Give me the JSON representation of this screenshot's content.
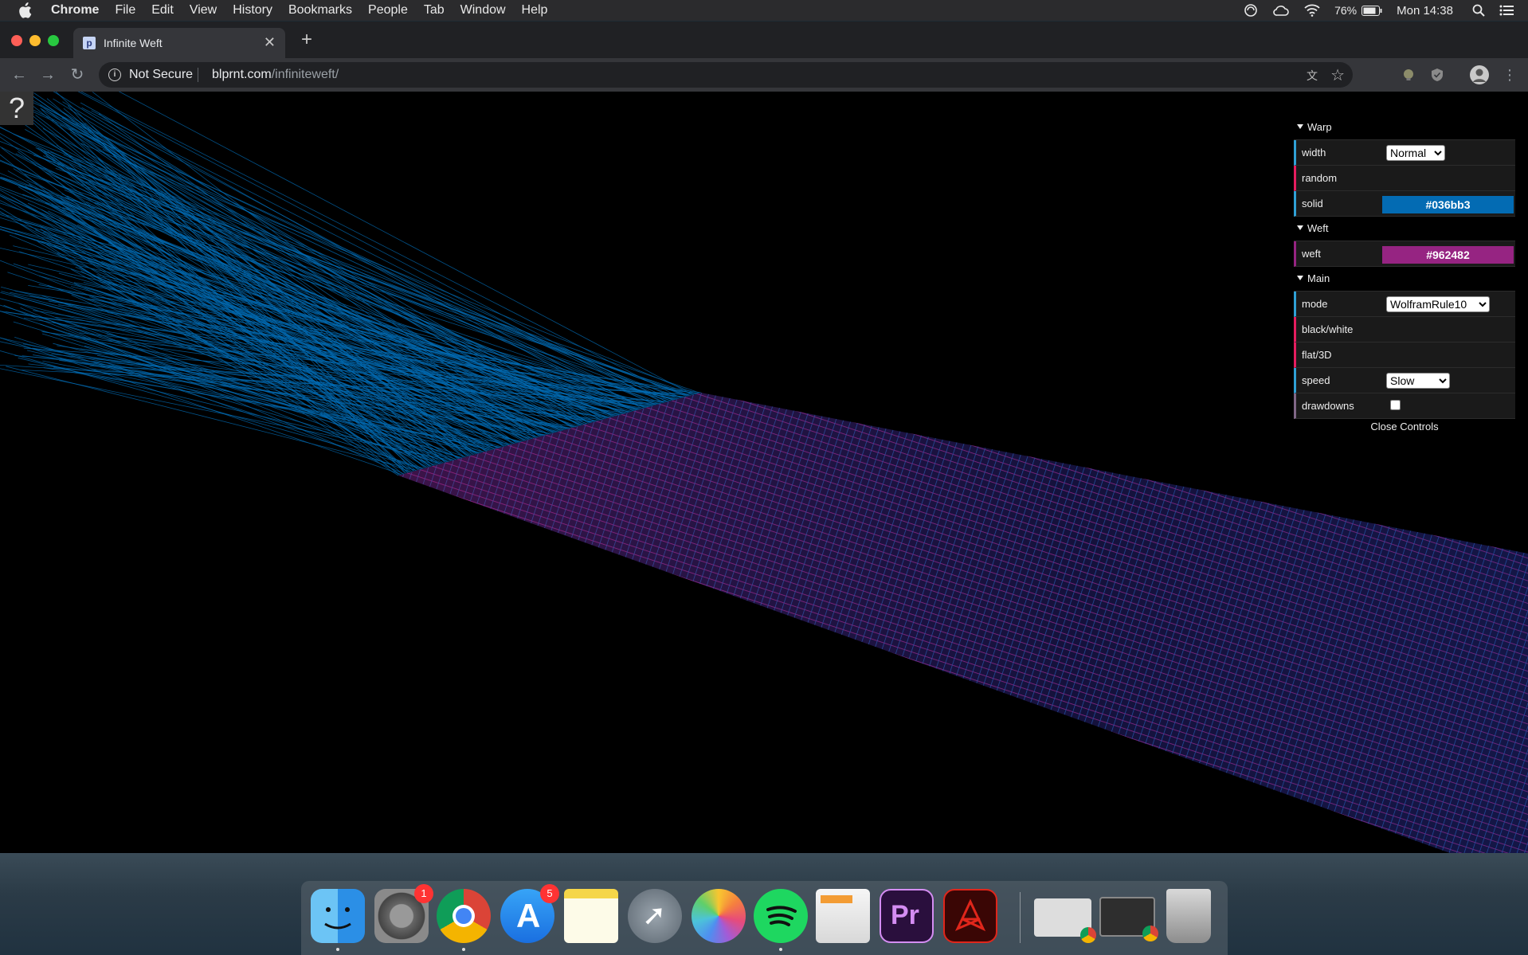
{
  "menubar": {
    "app_name": "Chrome",
    "items": [
      "File",
      "Edit",
      "View",
      "History",
      "Bookmarks",
      "People",
      "Tab",
      "Window",
      "Help"
    ],
    "battery": "76%",
    "clock": "Mon 14:38"
  },
  "browser": {
    "tab_title": "Infinite Weft",
    "security_label": "Not Secure",
    "url_host": "blprnt.com",
    "url_path": "/infiniteweft/"
  },
  "page": {
    "help_label": "?",
    "colors": {
      "warp": "#036bb3",
      "weft": "#962482"
    }
  },
  "gui": {
    "folders": {
      "warp": {
        "title": "Warp",
        "width_label": "width",
        "width_value": "Normal",
        "random_label": "random",
        "solid_label": "solid",
        "solid_value": "#036bb3"
      },
      "weft": {
        "title": "Weft",
        "weft_label": "weft",
        "weft_value": "#962482"
      },
      "main": {
        "title": "Main",
        "mode_label": "mode",
        "mode_value": "WolframRule10",
        "bw_label": "black/white",
        "flat_label": "flat/3D",
        "speed_label": "speed",
        "speed_value": "Slow",
        "drawdowns_label": "drawdowns",
        "drawdowns_checked": false
      }
    },
    "close_label": "Close Controls"
  },
  "dock": {
    "apps": [
      "finder-icon",
      "system-preferences-icon",
      "chrome-icon",
      "app-store-icon",
      "notes-icon",
      "launchpad-icon",
      "photos-icon",
      "spotify-icon",
      "pages-icon",
      "premiere-pro-icon",
      "acrobat-icon",
      "chrome-window-1-icon",
      "chrome-window-2-icon",
      "trash-icon"
    ],
    "system_prefs_badge": "1",
    "app_store_badge": "5",
    "premiere_label": "Pr"
  }
}
